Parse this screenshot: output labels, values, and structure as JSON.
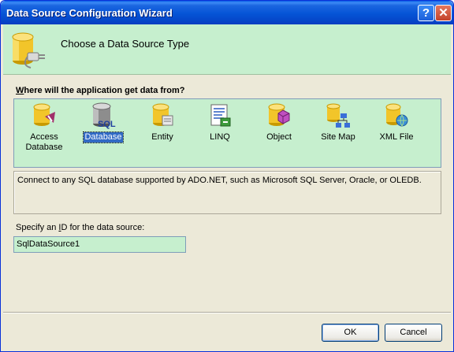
{
  "window": {
    "title": "Data Source Configuration Wizard",
    "help_glyph": "?",
    "close_glyph": "✕"
  },
  "header": {
    "title": "Choose a Data Source Type",
    "icon": "database-connector-icon"
  },
  "source_question": {
    "accesskey": "W",
    "rest": "here will the application get data from?"
  },
  "data_source_types": [
    {
      "label": "Access\nDatabase",
      "icon": "access-database-icon",
      "selected": false
    },
    {
      "label": "Database",
      "icon": "sql-database-icon",
      "selected": true
    },
    {
      "label": "Entity",
      "icon": "entity-icon",
      "selected": false
    },
    {
      "label": "LINQ",
      "icon": "linq-icon",
      "selected": false
    },
    {
      "label": "Object",
      "icon": "object-icon",
      "selected": false
    },
    {
      "label": "Site Map",
      "icon": "site-map-icon",
      "selected": false
    },
    {
      "label": "XML File",
      "icon": "xml-file-icon",
      "selected": false
    }
  ],
  "description": "Connect to any SQL database supported by ADO.NET, such as Microsoft SQL Server, Oracle, or OLEDB.",
  "id_field": {
    "label_before": "Specify an ",
    "label_accesskey": "I",
    "label_after": "D for the data source:",
    "value": "SqlDataSource1"
  },
  "buttons": {
    "ok": "OK",
    "cancel": "Cancel"
  },
  "colors": {
    "title_blue": "#0554d6",
    "panel_green": "#c6efce",
    "selection_blue": "#316ac5",
    "window_face": "#ece9d8"
  }
}
